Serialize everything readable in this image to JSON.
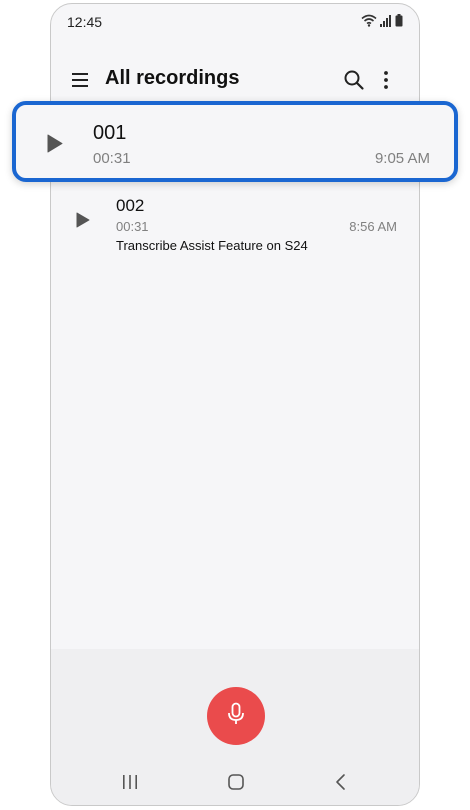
{
  "status_bar": {
    "time": "12:45",
    "icons": [
      "wifi-icon",
      "signal-icon",
      "battery-icon"
    ]
  },
  "app_bar": {
    "title": "All recordings",
    "icons": [
      "menu-icon",
      "search-icon",
      "more-options-icon"
    ]
  },
  "recordings": [
    {
      "name": "001",
      "duration": "00:31",
      "time": "9:05 AM",
      "note": "",
      "highlighted": true
    },
    {
      "name": "002",
      "duration": "00:31",
      "time": "8:56 AM",
      "note": "Transcribe Assist Feature on S24",
      "highlighted": false
    }
  ],
  "bottom": {
    "record_button_icon": "microphone-icon",
    "nav_icons": [
      "recent-apps-icon",
      "home-icon",
      "back-icon"
    ]
  },
  "colors": {
    "highlight_border": "#1a66d1",
    "record_button": "#ea4b4c",
    "background": "#f6f6f8"
  }
}
